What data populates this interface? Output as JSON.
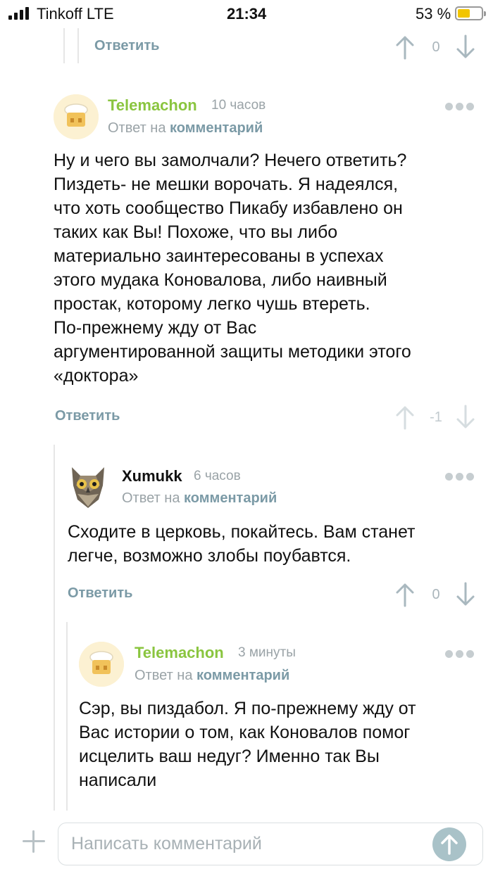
{
  "status_bar": {
    "carrier": "Tinkoff LTE",
    "time": "21:34",
    "battery_pct": "53 %",
    "battery_level": 0.53
  },
  "top_actions": {
    "reply_label": "Ответить",
    "score": "0"
  },
  "comments": [
    {
      "author": "Telemachon",
      "ago": "10 часов",
      "reply_prefix": "Ответ на",
      "reply_link": "комментарий",
      "lines": [
        "Ну и чего вы замолчали? Нечего ответить?",
        "Пиздеть- не мешки ворочать. Я надеялся,",
        "что хоть сообщество Пикабу избавлено он",
        "таких как Вы! Похоже, что вы либо",
        "материально заинтересованы в успехах",
        "этого мудака Коновалова, либо наивный",
        "простак, которому легко чушь втереть.",
        "По-прежнему жду от Вас",
        "аргументированной защиты методики этого",
        "«доктора»"
      ],
      "reply_label": "Ответить",
      "score": "-1",
      "avatar": "chef-hat-avatar"
    },
    {
      "author": "Xumukk",
      "ago": "6 часов",
      "reply_prefix": "Ответ на",
      "reply_link": "комментарий",
      "lines": [
        "Сходите в церковь, покайтесь. Вам станет",
        "легче, возможно злобы поубавтся."
      ],
      "reply_label": "Ответить",
      "score": "0",
      "avatar": "owl-avatar"
    },
    {
      "author": "Telemachon",
      "ago": "3 минуты",
      "reply_prefix": "Ответ на",
      "reply_link": "комментарий",
      "lines": [
        "Сэр, вы пиздабол. Я по-прежнему жду от",
        "Вас истории о том, как Коновалов помог",
        "исцелить ваш недуг? Именно так Вы",
        "написали"
      ],
      "avatar": "chef-hat-avatar"
    }
  ],
  "composer": {
    "placeholder": "Написать комментарий"
  },
  "colors": {
    "author_green": "#8ac53f",
    "link_blue_grey": "#7b9aa6",
    "meta_grey": "#9aa3a7"
  }
}
